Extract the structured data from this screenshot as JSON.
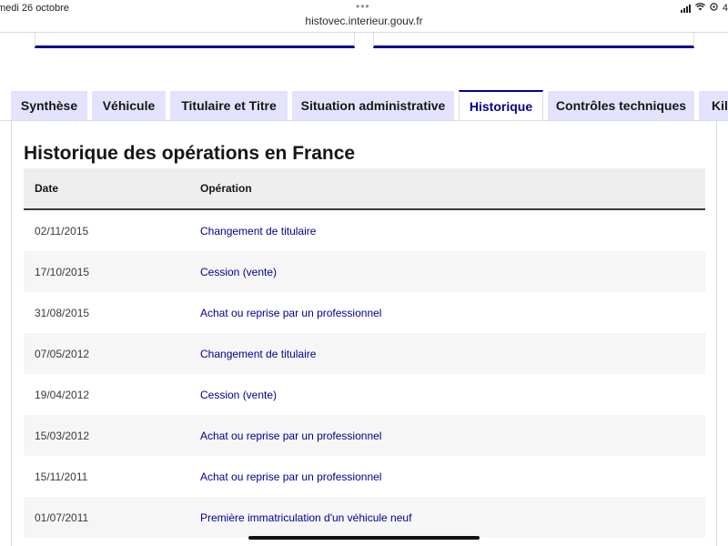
{
  "statusbar": {
    "date": "medi 26 octobre",
    "dots": "•••",
    "battery": "4"
  },
  "url": "histovec.interieur.gouv.fr",
  "tabs": [
    {
      "label": "Synthèse",
      "active": false
    },
    {
      "label": "Véhicule",
      "active": false
    },
    {
      "label": "Titulaire et Titre",
      "active": false
    },
    {
      "label": "Situation administrative",
      "active": false
    },
    {
      "label": "Historique",
      "active": true
    },
    {
      "label": "Contrôles techniques",
      "active": false
    },
    {
      "label": "Kilo",
      "active": false
    }
  ],
  "heading": "Historique des opérations en France",
  "table": {
    "headers": [
      "Date",
      "Opération"
    ],
    "rows": [
      {
        "date": "02/11/2015",
        "operation": "Changement de titulaire"
      },
      {
        "date": "17/10/2015",
        "operation": "Cession (vente)"
      },
      {
        "date": "31/08/2015",
        "operation": "Achat ou reprise par un professionnel"
      },
      {
        "date": "07/05/2012",
        "operation": "Changement de titulaire"
      },
      {
        "date": "19/04/2012",
        "operation": "Cession (vente)"
      },
      {
        "date": "15/03/2012",
        "operation": "Achat ou reprise par un professionnel"
      },
      {
        "date": "15/11/2011",
        "operation": "Achat ou reprise par un professionnel"
      },
      {
        "date": "01/07/2011",
        "operation": "Première immatriculation d'un véhicule neuf"
      }
    ]
  },
  "colors": {
    "accent": "#000091",
    "tab_bg": "#e3e3fd",
    "header_bg": "#eeeeee",
    "stripe": "#f6f6f6"
  }
}
